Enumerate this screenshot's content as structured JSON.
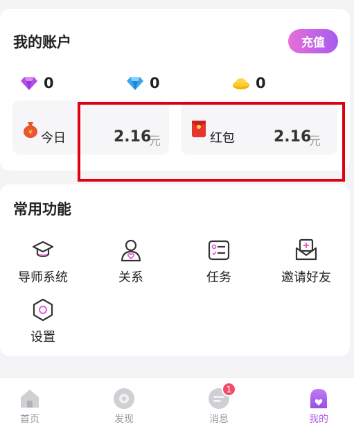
{
  "account": {
    "title": "我的账户",
    "recharge_label": "充值",
    "stats": [
      {
        "icon": "purple-diamond-icon",
        "value": "0"
      },
      {
        "icon": "blue-diamond-icon",
        "value": "0"
      },
      {
        "icon": "gold-ingot-icon",
        "value": "0"
      }
    ],
    "today": {
      "label": "今日",
      "value": "2.16",
      "unit": "元",
      "icon": "money-bag-icon"
    },
    "redpack": {
      "label": "红包",
      "value": "2.16",
      "unit": "元",
      "icon": "red-envelope-icon"
    }
  },
  "functions": {
    "title": "常用功能",
    "items": [
      {
        "label": "导师系统",
        "icon": "graduation-cap-icon"
      },
      {
        "label": "关系",
        "icon": "person-heart-icon"
      },
      {
        "label": "任务",
        "icon": "task-list-icon"
      },
      {
        "label": "邀请好友",
        "icon": "invite-envelope-icon"
      },
      {
        "label": "设置",
        "icon": "settings-hexagon-icon"
      }
    ]
  },
  "tabbar": {
    "tabs": [
      {
        "label": "首页",
        "icon": "home-icon"
      },
      {
        "label": "发现",
        "icon": "discover-icon"
      },
      {
        "label": "消息",
        "icon": "message-icon",
        "badge": "1"
      },
      {
        "label": "我的",
        "icon": "profile-icon",
        "active": true
      }
    ]
  },
  "colors": {
    "accent": "#b35bee",
    "highlight": "#e10010",
    "badge": "#f24b6a"
  }
}
